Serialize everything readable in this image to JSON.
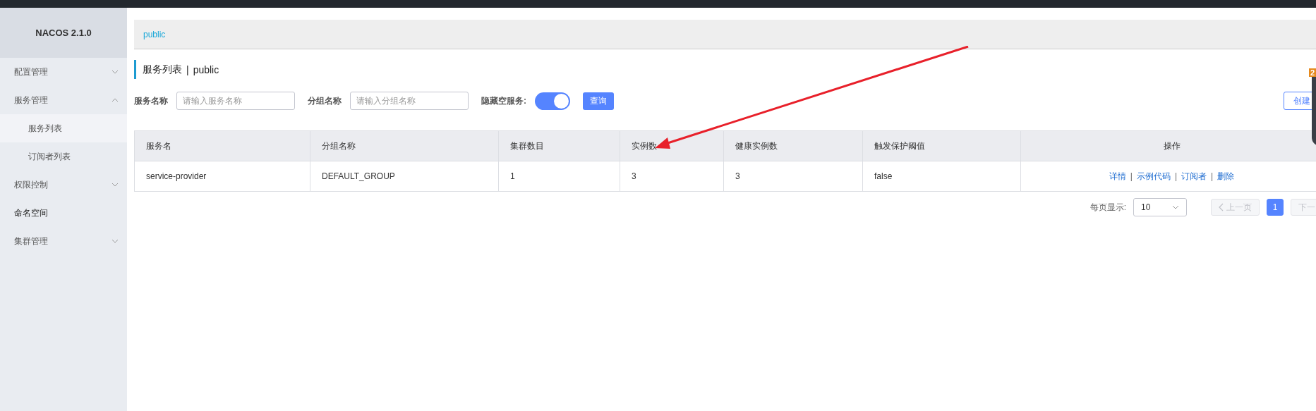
{
  "sidebar": {
    "title": "NACOS 2.1.0",
    "items": [
      {
        "label": "配置管理",
        "expanded": false
      },
      {
        "label": "服务管理",
        "expanded": true,
        "children": [
          {
            "label": "服务列表",
            "selected": true
          },
          {
            "label": "订阅者列表",
            "selected": false
          }
        ]
      },
      {
        "label": "权限控制",
        "expanded": false
      },
      {
        "label": "命名空间"
      },
      {
        "label": "集群管理",
        "expanded": false
      }
    ]
  },
  "namespace_bar": {
    "namespace": "public"
  },
  "heading": {
    "title": "服务列表",
    "separator": "|",
    "namespace": "public"
  },
  "filters": {
    "service_name": {
      "label": "服务名称",
      "placeholder": "请输入服务名称"
    },
    "group_name": {
      "label": "分组名称",
      "placeholder": "请输入分组名称"
    },
    "hide_empty": {
      "label": "隐藏空服务:",
      "on": true
    },
    "query_button": "查询",
    "create_button": "创建"
  },
  "table": {
    "columns": [
      "服务名",
      "分组名称",
      "集群数目",
      "实例数",
      "健康实例数",
      "触发保护阈值",
      "操作"
    ],
    "rows": [
      {
        "cells": [
          "service-provider",
          "DEFAULT_GROUP",
          "1",
          "3",
          "3",
          "false"
        ],
        "actions": [
          "详情",
          "示例代码",
          "订阅者",
          "删除"
        ],
        "action_separator": "|"
      }
    ]
  },
  "pagination": {
    "page_size_label": "每页显示:",
    "page_size": "10",
    "prev": {
      "label": "上一页",
      "disabled": true
    },
    "pages": [
      {
        "label": "1",
        "selected": true
      }
    ],
    "next": {
      "label": "下一",
      "disabled": true
    }
  },
  "overlay_widget": {
    "badge": "2"
  }
}
